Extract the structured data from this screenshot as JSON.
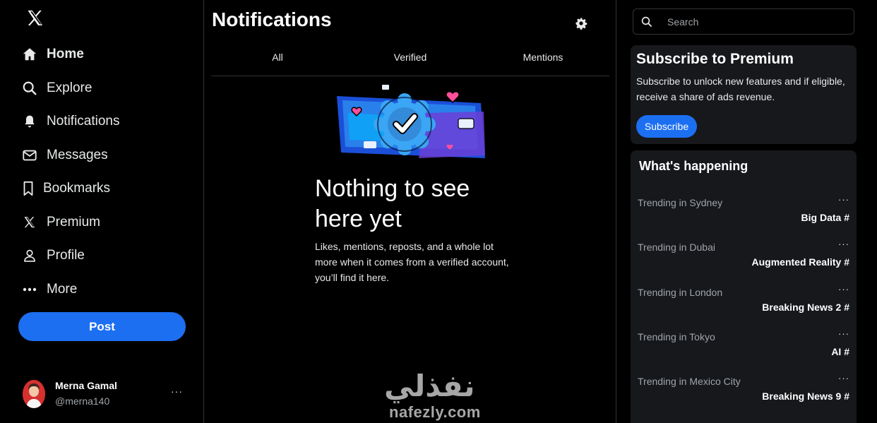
{
  "sidebar": {
    "items": [
      {
        "label": "Home",
        "icon": "home-icon"
      },
      {
        "label": "Explore",
        "icon": "search-icon"
      },
      {
        "label": "Notifications",
        "icon": "bell-icon"
      },
      {
        "label": "Messages",
        "icon": "envelope-icon"
      },
      {
        "label": "Bookmarks",
        "icon": "bookmark-icon"
      },
      {
        "label": "Premium",
        "icon": "x-logo-icon"
      },
      {
        "label": "Profile",
        "icon": "person-icon"
      },
      {
        "label": "More",
        "icon": "more-circle-icon"
      }
    ],
    "post_label": "Post",
    "user": {
      "name": "Merna Gamal",
      "handle": "@merna140",
      "more": "···"
    }
  },
  "main": {
    "title": "Notifications",
    "tabs": [
      {
        "label": "All"
      },
      {
        "label": "Verified"
      },
      {
        "label": "Mentions"
      }
    ],
    "empty_title": "Nothing to see here yet",
    "empty_desc": "Likes, mentions, reposts, and a whole lot more when it comes from a verified account, you’ll find it here."
  },
  "watermark": {
    "arabic": "نفذلي",
    "latin": "nafezly.com"
  },
  "right": {
    "search": {
      "placeholder": "Search"
    },
    "premium": {
      "title": "Subscribe to Premium",
      "desc": "Subscribe to unlock new features and if eligible, receive a share of ads revenue.",
      "button": "Subscribe"
    },
    "trends": {
      "title": "What's happening",
      "items": [
        {
          "context": "Trending in Sydney",
          "name": "Big Data #"
        },
        {
          "context": "Trending in Dubai",
          "name": "Augmented Reality #"
        },
        {
          "context": "Trending in London",
          "name": "Breaking News 2 #"
        },
        {
          "context": "Trending in Tokyo",
          "name": "AI #"
        },
        {
          "context": "Trending in Mexico City",
          "name": "Breaking News 9 #"
        }
      ],
      "more": "···"
    }
  },
  "colors": {
    "accent": "#1d6ff2",
    "background": "#000000",
    "card": "#16181c",
    "border": "#2f3336"
  }
}
